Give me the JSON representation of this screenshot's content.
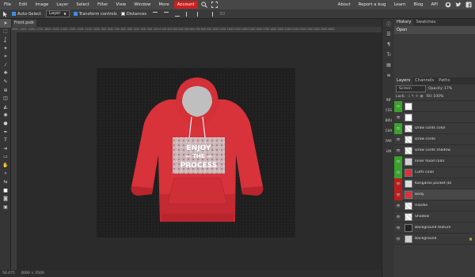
{
  "menu": {
    "items": [
      "File",
      "Edit",
      "Image",
      "Layer",
      "Select",
      "Filter",
      "View",
      "Window",
      "More"
    ],
    "account": "Account",
    "right_items": [
      "About",
      "Report a bug",
      "Learn",
      "Blog",
      "API"
    ]
  },
  "options": {
    "auto_select": "Auto-Select",
    "layer_select": "Layer",
    "transform_controls": "Transform controls",
    "distances": "Distances",
    "three_d": "3D"
  },
  "document": {
    "tab_label": "Front.psd",
    "close": "×",
    "status_zoom": "56.475",
    "status_size": "4000 × 3500"
  },
  "ruler_text": "-2000 -1900 -1800 -1700 -1600 -1500 -1400 -1300 -1200 -1100 -1000 -900 -800 -700 -600 -500 -400 -300 -200 -100 0 100 200 300 400 500 600 700 800 900 1000 1100 1200 1300 1400 1500 1600 1700 1800 1900 2000 2100 2200 2300 2400 2500 2600",
  "artwork": {
    "line1": "ENJOY",
    "line2": "— THE —",
    "line3": "PROCESS"
  },
  "midbar": [
    "INF",
    "CSS",
    "BRU",
    "CHA",
    "PAR",
    "LIN"
  ],
  "history_panel": {
    "tabs": [
      "History",
      "Swatches"
    ],
    "entry": "Open"
  },
  "layers_panel": {
    "tabs": [
      "Layers",
      "Channels",
      "Paths"
    ],
    "blend_mode": "Screen",
    "opacity_label": "Opacity:",
    "opacity": "17%",
    "lock_label": "Lock:",
    "fill_label": "Fill:",
    "fill": "100%",
    "layers": [
      {
        "name": "",
        "eye": "green",
        "thumb": "white"
      },
      {
        "name": "",
        "eye": "none",
        "thumb": "white"
      },
      {
        "name": "Draw cords color",
        "eye": "green",
        "thumb": "checker"
      },
      {
        "name": "Draw cords",
        "eye": "none",
        "thumb": "checker"
      },
      {
        "name": "Draw cords shadow",
        "eye": "none",
        "thumb": "checker"
      },
      {
        "name": "Inner hood color",
        "eye": "green",
        "thumb": "gray"
      },
      {
        "name": "Cuffs color",
        "eye": "green",
        "thumb": "red"
      },
      {
        "name": "Kangaroo pocket (bl",
        "eye": "red",
        "thumb": "hood"
      },
      {
        "name": "Body",
        "eye": "red",
        "thumb": "red"
      },
      {
        "name": "Hoodie",
        "eye": "none",
        "thumb": "checker"
      },
      {
        "name": "Shadow",
        "eye": "none",
        "thumb": "checker"
      },
      {
        "name": "Background texture",
        "eye": "none",
        "thumb": "dark"
      },
      {
        "name": "Background",
        "eye": "none",
        "thumb": "gray"
      }
    ]
  },
  "colors": {
    "accent": "#c8201e",
    "hoodie": "#d8323a",
    "eye_green": "#3aa12c",
    "eye_red": "#bb1d1d"
  }
}
